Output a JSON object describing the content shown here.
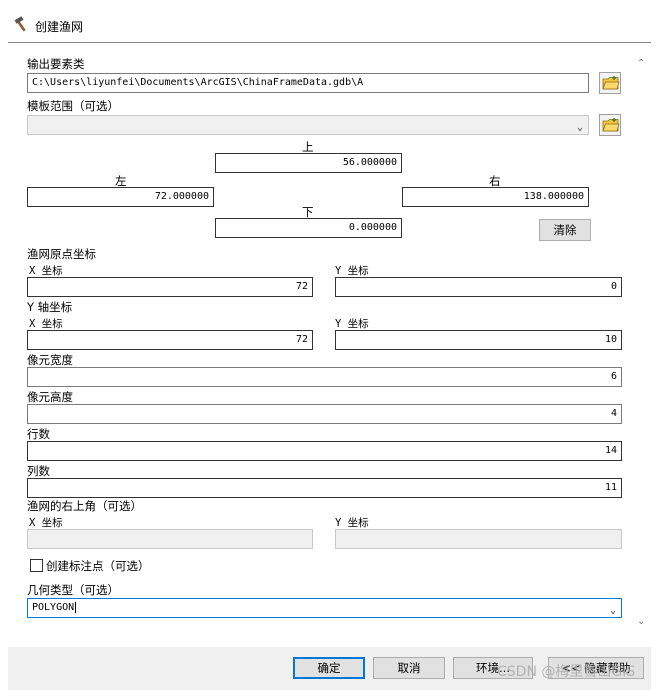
{
  "window": {
    "title": "创建渔网",
    "icon": "hammer-icon"
  },
  "output": {
    "label": "输出要素类",
    "value": "C:\\Users\\liyunfei\\Documents\\ArcGIS\\ChinaFrameData.gdb\\A"
  },
  "template": {
    "label": "模板范围（可选）",
    "value": ""
  },
  "extent": {
    "top_label": "上",
    "top_value": "56.000000",
    "left_label": "左",
    "left_value": "72.000000",
    "right_label": "右",
    "right_value": "138.000000",
    "bottom_label": "下",
    "bottom_value": "0.000000",
    "clear_label": "清除"
  },
  "origin": {
    "label": "渔网原点坐标",
    "x_label": "X 坐标",
    "x_value": "72",
    "y_label": "Y 坐标",
    "y_value": "0"
  },
  "yaxis": {
    "label": "Y 轴坐标",
    "x_label": "X 坐标",
    "x_value": "72",
    "y_label": "Y 坐标",
    "y_value": "10"
  },
  "cell_width": {
    "label": "像元宽度",
    "value": "6"
  },
  "cell_height": {
    "label": "像元高度",
    "value": "4"
  },
  "rows": {
    "label": "行数",
    "value": "14"
  },
  "cols": {
    "label": "列数",
    "value": "11"
  },
  "corner": {
    "label": "渔网的右上角（可选）",
    "x_label": "X 坐标",
    "x_value": "",
    "y_label": "Y 坐标",
    "y_value": ""
  },
  "label_points": {
    "label": "创建标注点（可选）",
    "checked": false
  },
  "geometry": {
    "label": "几何类型（可选）",
    "value": "POLYGON"
  },
  "buttons": {
    "ok": "确定",
    "cancel": "取消",
    "environments": "环境...",
    "hide_help": "<< 隐藏帮助"
  },
  "watermark": "CSDN @梅里雪山GIS",
  "colors": {
    "focus": "#0078d7",
    "folder": "#f5c542"
  }
}
